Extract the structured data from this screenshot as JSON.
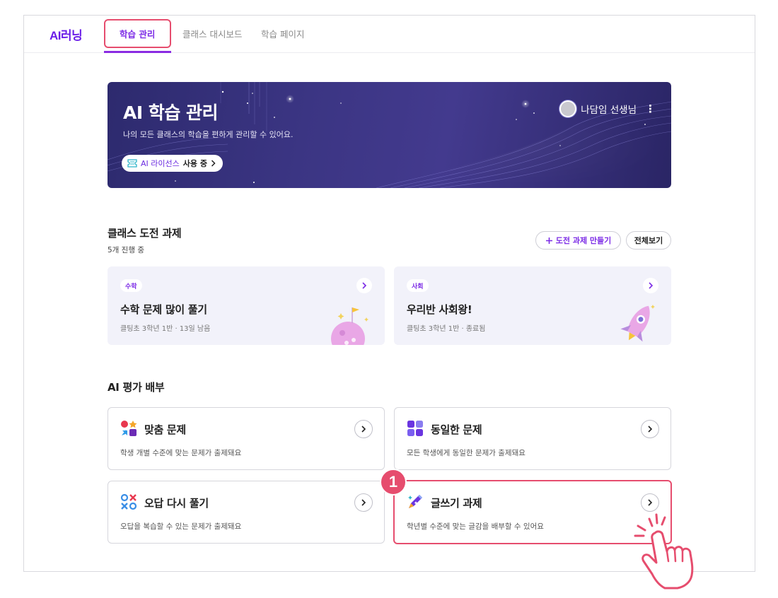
{
  "nav": {
    "logo": "AI러닝",
    "tabs": [
      "학습 관리",
      "클래스 대시보드",
      "학습 페이지"
    ],
    "active_tab": "학습 관리"
  },
  "banner": {
    "title": "AI 학습 관리",
    "description": "나의 모든 클래스의 학습을 편하게 관리할 수 있어요.",
    "license_name": "AI 라이선스",
    "license_status": "사용 중",
    "user_name": "나담임 선생님"
  },
  "challenge": {
    "title": "클래스 도전 과제",
    "count_text": "5개 진행 중",
    "create_button": "도전 과제 만들기",
    "view_all_button": "전체보기",
    "cards": [
      {
        "tag": "수학",
        "title": "수학 문제 많이 풀기",
        "meta": "클팅초 3학년 1반 · 13일 남음"
      },
      {
        "tag": "사회",
        "title": "우리반 사회왕!",
        "meta": "클팅초 3학년 1반 · 종료됨"
      }
    ]
  },
  "evaluation": {
    "title": "AI 평가 배부",
    "cards": [
      {
        "icon": "custom-problem-icon",
        "title": "맞춤 문제",
        "desc": "학생 개별 수준에 맞는 문제가 출제돼요"
      },
      {
        "icon": "same-problem-icon",
        "title": "동일한 문제",
        "desc": "모든 학생에게 동일한 문제가 출제돼요"
      },
      {
        "icon": "wrong-answer-icon",
        "title": "오답 다시 풀기",
        "desc": "오답을 복습할 수 있는 문제가 출제돼요"
      },
      {
        "icon": "writing-pen-icon",
        "title": "글쓰기 과제",
        "desc": "학년별 수준에 맞는 글감을 배부할 수 있어요"
      }
    ]
  },
  "annotation": {
    "step_number": "1"
  },
  "colors": {
    "brand": "#7c2ce6",
    "highlight": "#e64d6e",
    "banner": "#3b3583"
  }
}
